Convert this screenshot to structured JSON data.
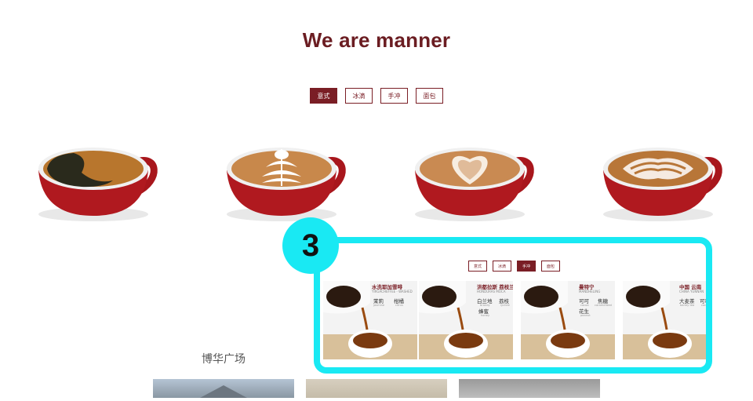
{
  "title": "We are manner",
  "tabs": [
    {
      "label": "意式",
      "active": true
    },
    {
      "label": "冰滴",
      "active": false
    },
    {
      "label": "手冲",
      "active": false
    },
    {
      "label": "面包",
      "active": false
    }
  ],
  "cups": [
    {
      "name": "black-coffee"
    },
    {
      "name": "tulip-latte"
    },
    {
      "name": "heart-latte"
    },
    {
      "name": "rosetta-latte"
    }
  ],
  "section_caption": "博华广场",
  "callout": {
    "number": "3",
    "tabs": [
      {
        "label": "意式",
        "active": false
      },
      {
        "label": "冰滴",
        "active": false
      },
      {
        "label": "手冲",
        "active": true
      },
      {
        "label": "面包",
        "active": false
      }
    ],
    "panels": [
      {
        "title": "水洗耶加雪啡",
        "subtitle": "YIRGACHEFFEE - WASHED",
        "notes": [
          {
            "cn": "茉莉",
            "en": "jasmine"
          },
          {
            "cn": "柑橘",
            "en": "citrus"
          }
        ]
      },
      {
        "title": "洪都拉斯 荔枝兰",
        "subtitle": "HONDURAS MOCA",
        "notes": [
          {
            "cn": "白兰地",
            "en": "brandy"
          },
          {
            "cn": "荔枝",
            "en": "lychee"
          },
          {
            "cn": "蜂蜜",
            "en": "honey"
          }
        ]
      },
      {
        "title": "曼特宁",
        "subtitle": "MANDHELING",
        "notes": [
          {
            "cn": "可可",
            "en": "cocoa"
          },
          {
            "cn": "焦糖",
            "en": "caramelized"
          },
          {
            "cn": "花生",
            "en": "peanut"
          }
        ]
      },
      {
        "title": "中国 云南",
        "subtitle": "CHINA YUNNAN",
        "notes": [
          {
            "cn": "大麦茶",
            "en": "barley tea"
          },
          {
            "cn": "可可",
            "en": "cocoa"
          }
        ]
      }
    ]
  }
}
